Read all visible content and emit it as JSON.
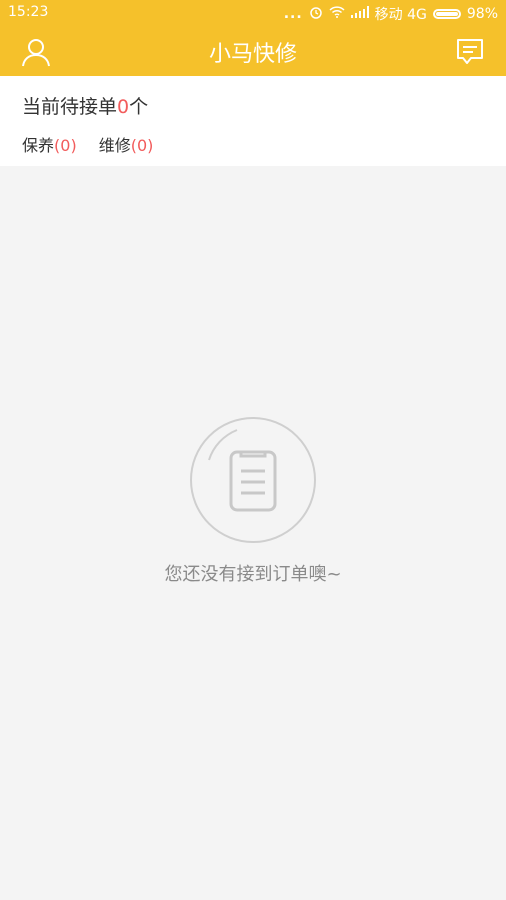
{
  "status_bar": {
    "time": "15:23",
    "dots": "...",
    "carrier": "移动 4G",
    "battery_percent": "98%",
    "battery_level": 0.98
  },
  "header": {
    "title": "小马快修",
    "left_icon": "user-icon",
    "right_icon": "message-icon",
    "background": "#f5c12b"
  },
  "summary": {
    "pending_prefix": "当前待接单",
    "pending_count": "0",
    "pending_suffix": "个",
    "maintenance_label": "保养",
    "maintenance_count": "(0)",
    "repair_label": "维修",
    "repair_count": "(0)",
    "accent": "#f25c5c"
  },
  "empty_state": {
    "icon": "clipboard-icon",
    "message": "您还没有接到订单噢~"
  }
}
